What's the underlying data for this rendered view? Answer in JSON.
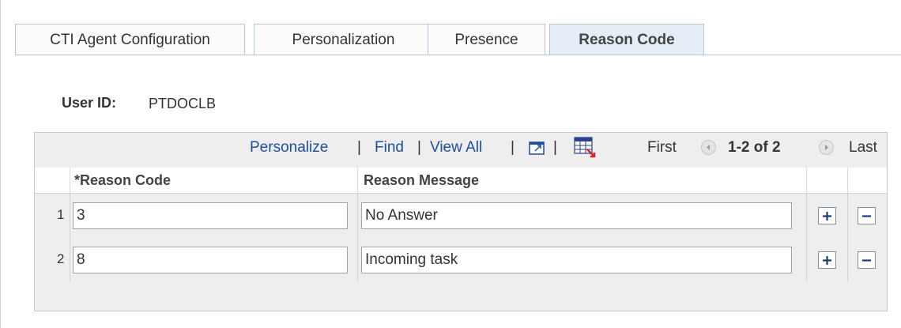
{
  "tabs": [
    {
      "label": "CTI Agent Configuration",
      "active": false
    },
    {
      "label": "Personalization",
      "active": false
    },
    {
      "label": "Presence",
      "active": false
    },
    {
      "label": "Reason Code",
      "active": true
    }
  ],
  "user": {
    "label": "User ID:",
    "value": "PTDOCLB"
  },
  "grid": {
    "nav": {
      "personalize": "Personalize",
      "find": "Find",
      "view_all": "View All",
      "separator": "|",
      "first": "First",
      "range": "1-2 of 2",
      "last": "Last"
    },
    "columns": [
      "*Reason Code",
      "Reason Message"
    ],
    "rows": [
      {
        "num": "1",
        "reason_code": "3",
        "reason_message": "No Answer"
      },
      {
        "num": "2",
        "reason_code": "8",
        "reason_message": "Incoming task"
      }
    ]
  },
  "icons": {
    "zoom": "zoom-window-icon",
    "download": "download-grid-icon",
    "prev": "previous-arrow-icon",
    "next": "next-arrow-icon",
    "add": "add-row-icon",
    "delete": "delete-row-icon"
  },
  "colors": {
    "link": "#1f4d9e",
    "active_tab": "#e5eef6",
    "grid_bg": "#eeeeee"
  }
}
